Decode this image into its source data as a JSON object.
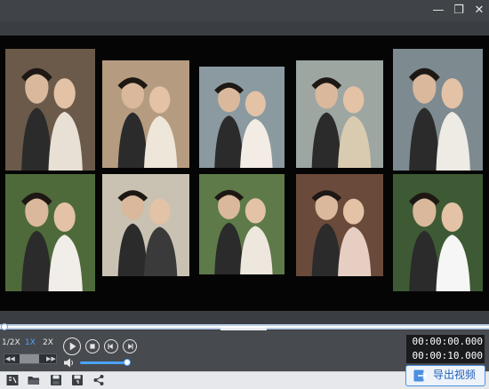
{
  "window": {
    "minimize_glyph": "—",
    "restore_glyph": "❐",
    "close_glyph": "✕"
  },
  "photos": [
    {
      "id": "r1c1",
      "bg": "#6b5a4a",
      "accent": "#e8e0d4"
    },
    {
      "id": "r1c2",
      "bg": "#b59c80",
      "accent": "#efe6da"
    },
    {
      "id": "r1c3",
      "bg": "#8a9aa0",
      "accent": "#f2ece4"
    },
    {
      "id": "r1c4",
      "bg": "#9ea6a2",
      "accent": "#d9cbb0"
    },
    {
      "id": "r1c5",
      "bg": "#7d8a90",
      "accent": "#eeeae4"
    },
    {
      "id": "r2c1",
      "bg": "#4e6a3a",
      "accent": "#f1ede8"
    },
    {
      "id": "r2c2",
      "bg": "#c9c2b2",
      "accent": "#3a3a3a"
    },
    {
      "id": "r2c3",
      "bg": "#5d7a48",
      "accent": "#ede7dd"
    },
    {
      "id": "r2c4",
      "bg": "#6a4a3a",
      "accent": "#e6cfc2"
    },
    {
      "id": "r2c5",
      "bg": "#3d5a34",
      "accent": "#f6f6f6"
    }
  ],
  "player": {
    "speeds": [
      "1/2X",
      "1X",
      "2X"
    ],
    "active_speed": "1X",
    "volume_level": 0.9,
    "playback_progress": 0.0
  },
  "timecodes": {
    "current": "00:00:00.000",
    "total": "00:00:10.000"
  },
  "toolbar": {
    "export_label": "导出视频"
  },
  "colors": {
    "accent": "#4aa3ff",
    "export_border": "#4a8fe0",
    "export_text": "#1f5fb8"
  }
}
